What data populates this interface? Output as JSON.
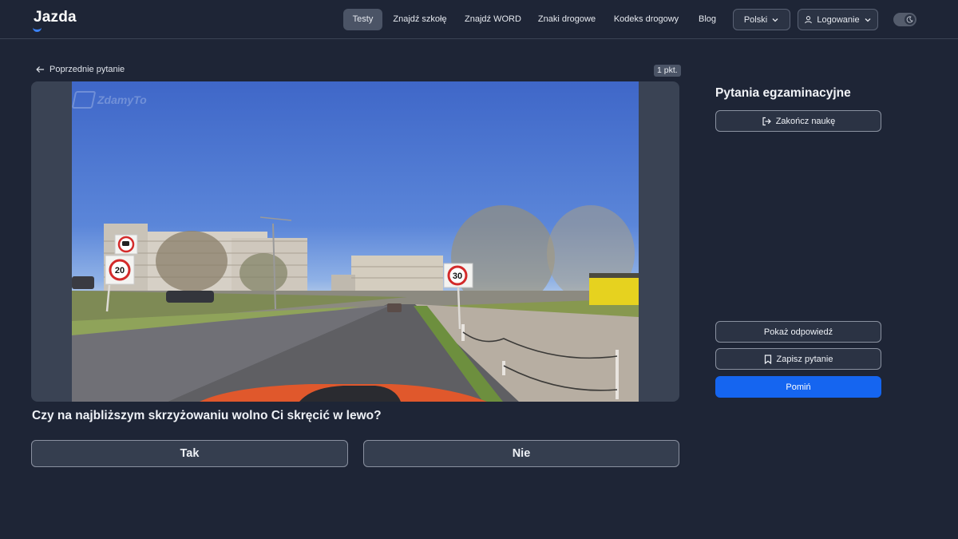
{
  "brand": {
    "logo_text": "Jazda",
    "accent_color": "#3b82f6"
  },
  "nav": {
    "items": [
      {
        "label": "Testy",
        "active": true
      },
      {
        "label": "Znajdź szkołę",
        "active": false
      },
      {
        "label": "Znajdź WORD",
        "active": false
      },
      {
        "label": "Znaki drogowe",
        "active": false
      },
      {
        "label": "Kodeks drogowy",
        "active": false
      },
      {
        "label": "Blog",
        "active": false
      }
    ],
    "language_label": "Polski",
    "login_label": "Logowanie",
    "theme_toggle_icon": "moon-icon"
  },
  "question_view": {
    "prev_label": "Poprzednie pytanie",
    "points_badge": "1 pkt.",
    "media_watermark": "ZdamyTo",
    "scene_signs": [
      "20",
      "30"
    ],
    "question_text": "Czy na najbliższym skrzyżowaniu wolno Ci skręcić w lewo?",
    "answers": [
      "Tak",
      "Nie"
    ]
  },
  "side_panel": {
    "title": "Pytania egzaminacyjne",
    "finish_label": "Zakończ naukę",
    "show_answer_label": "Pokaż odpowiedź",
    "save_question_label": "Zapisz pytanie",
    "skip_label": "Pomiń",
    "skip_color": "#1565f0"
  }
}
